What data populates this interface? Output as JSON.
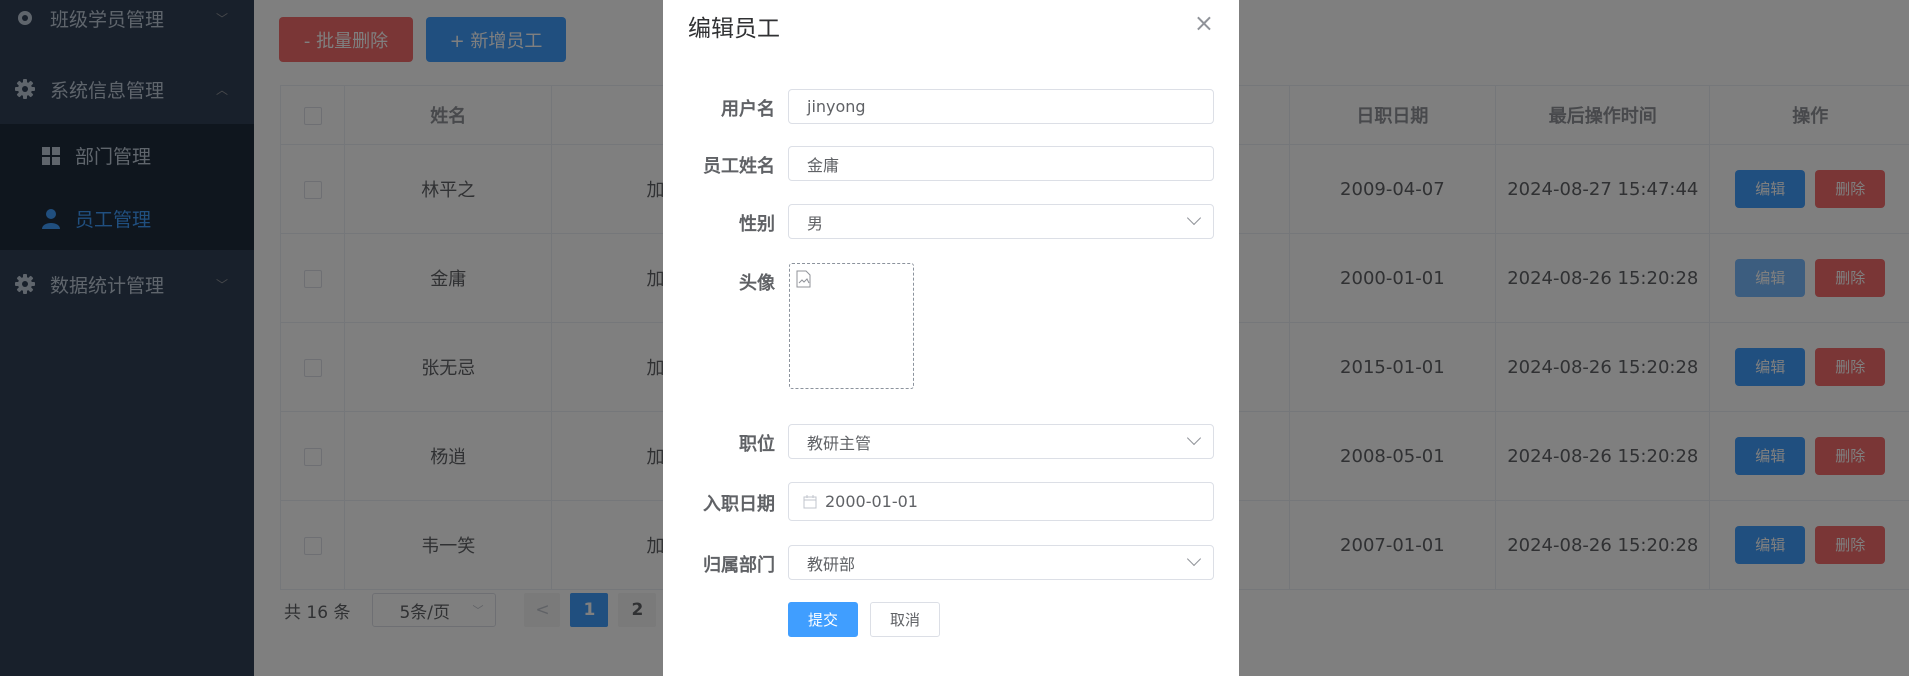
{
  "sidebar": {
    "menu_class": "班级学员管理",
    "menu_system": "系统信息管理",
    "sub_dept": "部门管理",
    "sub_emp": "员工管理",
    "menu_stats": "数据统计管理"
  },
  "toolbar": {
    "batch_delete_label": "- 批量删除",
    "add_employee_label": "+ 新增员工"
  },
  "table": {
    "headers": {
      "name": "姓名",
      "entry_date": "日职日期",
      "last_op": "最后操作时间",
      "actions": "操作"
    },
    "rows": [
      {
        "name": "林平之",
        "extra": "加",
        "entry_date": "2009-04-07",
        "last_op": "2024-08-27 15:47:44"
      },
      {
        "name": "金庸",
        "extra": "加",
        "entry_date": "2000-01-01",
        "last_op": "2024-08-26 15:20:28"
      },
      {
        "name": "张无忌",
        "extra": "加",
        "entry_date": "2015-01-01",
        "last_op": "2024-08-26 15:20:28"
      },
      {
        "name": "杨逍",
        "extra": "加",
        "entry_date": "2008-05-01",
        "last_op": "2024-08-26 15:20:28"
      },
      {
        "name": "韦一笑",
        "extra": "加",
        "entry_date": "2007-01-01",
        "last_op": "2024-08-26 15:20:28"
      }
    ],
    "edit_label": "编辑",
    "delete_label": "删除"
  },
  "pager": {
    "total": "共 16 条",
    "page_size": "5条/页",
    "pages": [
      "1",
      "2"
    ],
    "current": "1"
  },
  "dialog": {
    "title": "编辑员工",
    "close_glyph": "×",
    "fields": {
      "username": {
        "label": "用户名",
        "value": "jinyong"
      },
      "name": {
        "label": "员工姓名",
        "value": "金庸"
      },
      "gender": {
        "label": "性别",
        "value": "男"
      },
      "avatar": {
        "label": "头像"
      },
      "job": {
        "label": "职位",
        "value": "教研主管"
      },
      "entry_date": {
        "label": "入职日期",
        "value": "2000-01-01"
      },
      "dept": {
        "label": "归属部门",
        "value": "教研部"
      }
    },
    "submit_label": "提交",
    "cancel_label": "取消"
  },
  "colors": {
    "sidebar_bg": "#304156",
    "primary": "#409eff",
    "danger": "#f56c6c",
    "overlay": "rgba(0,0,0,0.5)"
  }
}
